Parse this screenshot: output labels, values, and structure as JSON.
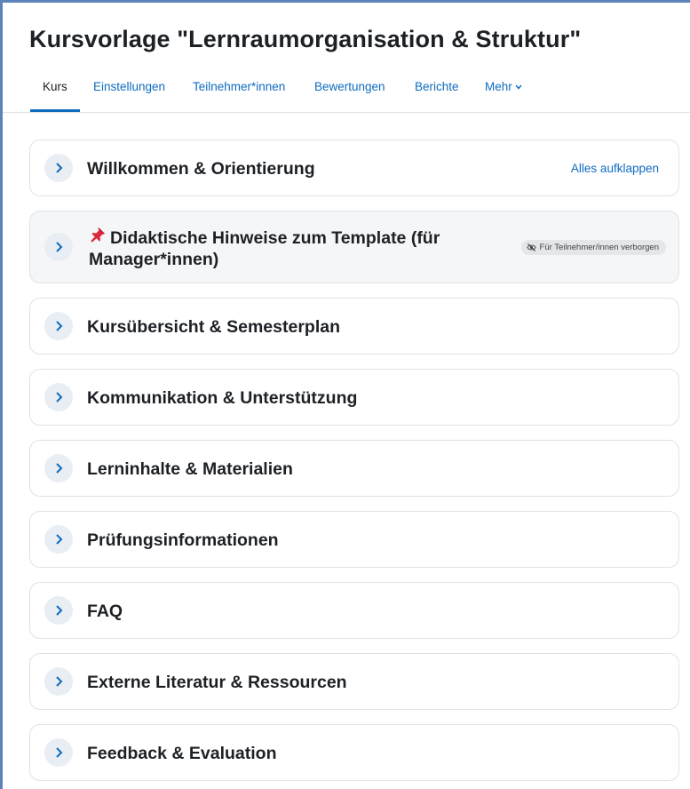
{
  "course": {
    "title": "Kursvorlage \"Lernraumorganisation & Struktur\""
  },
  "nav": {
    "items": [
      {
        "label": "Kurs",
        "active": true
      },
      {
        "label": "Einstellungen"
      },
      {
        "label": "Teilnehmer*innen"
      },
      {
        "label": "Bewertungen"
      },
      {
        "label": "Berichte"
      },
      {
        "label": "Mehr"
      }
    ]
  },
  "sections": [
    {
      "title": "Willkommen & Orientierung",
      "action": "Alles aufklappen"
    },
    {
      "title_line1": "Didaktische Hinweise zum Template (für",
      "title_line2": "Manager*innen)",
      "icon": "pushpin-icon",
      "badge": "Für Teilnehmer/innen verborgen",
      "badge_icon": "eye-slash-icon"
    },
    {
      "title": "Kursübersicht & Semesterplan"
    },
    {
      "title": "Kommunikation & Unterstützung"
    },
    {
      "title": "Lerninhalte & Materialien"
    },
    {
      "title": "Prüfungsinformationen"
    },
    {
      "title": "FAQ"
    },
    {
      "title": "Externe Literatur & Ressourcen"
    },
    {
      "title": "Feedback & Evaluation"
    }
  ],
  "colors": {
    "accent": "#0f6cbf",
    "frame": "#5b83b8",
    "toggle_bg": "#e9eef4",
    "highlight_bg": "#f5f6f7"
  }
}
